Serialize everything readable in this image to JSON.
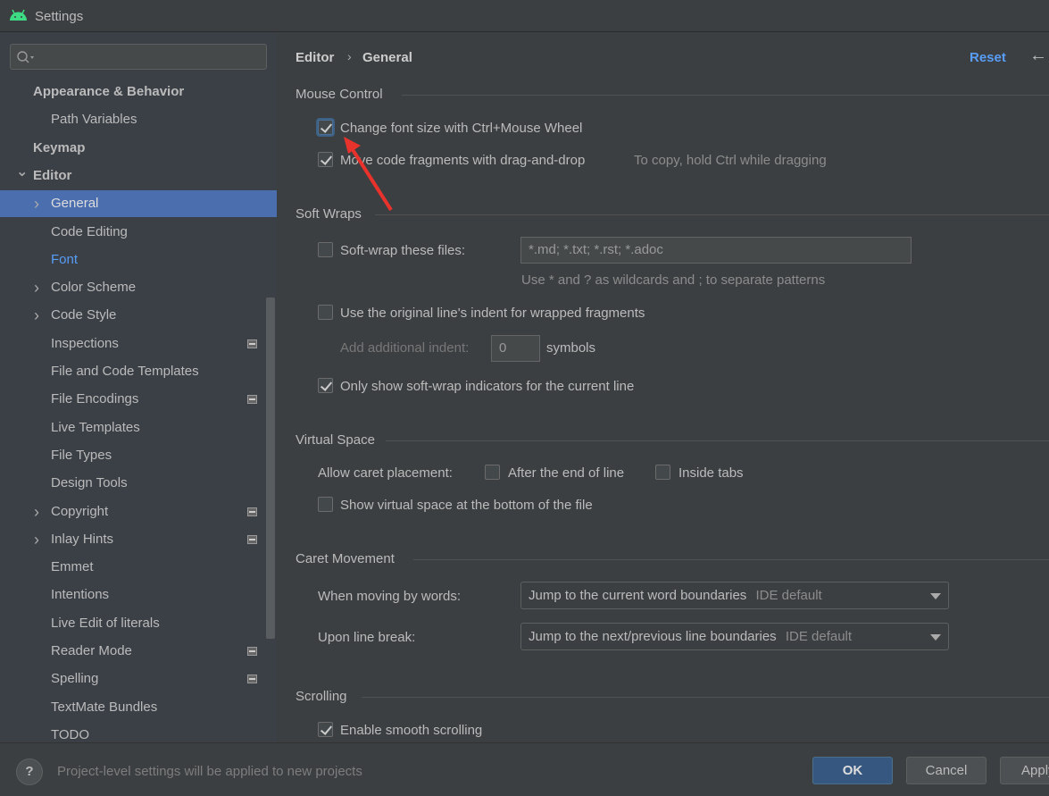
{
  "window": {
    "title": "Settings",
    "icon": "android-icon"
  },
  "search": {
    "placeholder": "",
    "icon": "search-icon"
  },
  "sidebar": {
    "items": [
      {
        "label": "Appearance & Behavior",
        "level": 0,
        "bold": true
      },
      {
        "label": "Path Variables",
        "level": 1
      },
      {
        "label": "Keymap",
        "level": 0,
        "bold": true
      },
      {
        "label": "Editor",
        "level": 0,
        "bold": true,
        "chevron": "down"
      },
      {
        "label": "General",
        "level": 1,
        "chevron": "right",
        "selected": true
      },
      {
        "label": "Code Editing",
        "level": 1
      },
      {
        "label": "Font",
        "level": 1,
        "color": "#589df6"
      },
      {
        "label": "Color Scheme",
        "level": 1,
        "chevron": "right"
      },
      {
        "label": "Code Style",
        "level": 1,
        "chevron": "right"
      },
      {
        "label": "Inspections",
        "level": 1,
        "project_icon": true
      },
      {
        "label": "File and Code Templates",
        "level": 1
      },
      {
        "label": "File Encodings",
        "level": 1,
        "project_icon": true
      },
      {
        "label": "Live Templates",
        "level": 1
      },
      {
        "label": "File Types",
        "level": 1
      },
      {
        "label": "Design Tools",
        "level": 1
      },
      {
        "label": "Copyright",
        "level": 1,
        "chevron": "right",
        "project_icon": true
      },
      {
        "label": "Inlay Hints",
        "level": 1,
        "chevron": "right",
        "project_icon": true
      },
      {
        "label": "Emmet",
        "level": 1
      },
      {
        "label": "Intentions",
        "level": 1
      },
      {
        "label": "Live Edit of literals",
        "level": 1
      },
      {
        "label": "Reader Mode",
        "level": 1,
        "project_icon": true
      },
      {
        "label": "Spelling",
        "level": 1,
        "project_icon": true
      },
      {
        "label": "TextMate Bundles",
        "level": 1
      },
      {
        "label": "TODO",
        "level": 1
      }
    ]
  },
  "header": {
    "breadcrumb": [
      "Editor",
      "General"
    ],
    "separator": "›",
    "reset": "Reset",
    "back_icon": "arrow-left-icon"
  },
  "mouse_control": {
    "title": "Mouse Control",
    "change_font": {
      "label": "Change font size with Ctrl+Mouse Wheel",
      "checked": true
    },
    "drag_drop": {
      "label": "Move code fragments with drag-and-drop",
      "checked": true,
      "hint": "To copy, hold Ctrl while dragging"
    }
  },
  "soft_wraps": {
    "title": "Soft Wraps",
    "soft_wrap_files": {
      "label": "Soft-wrap these files:",
      "checked": false,
      "value": "*.md; *.txt; *.rst; *.adoc",
      "hint": "Use * and ? as wildcards and ; to separate patterns"
    },
    "original_indent": {
      "label": "Use the original line's indent for wrapped fragments",
      "checked": false
    },
    "additional_indent": {
      "label": "Add additional indent:",
      "value": "0",
      "unit": "symbols"
    },
    "only_current": {
      "label": "Only show soft-wrap indicators for the current line",
      "checked": true
    }
  },
  "virtual_space": {
    "title": "Virtual Space",
    "caret_label": "Allow caret placement:",
    "after_end": {
      "label": "After the end of line",
      "checked": false
    },
    "inside_tabs": {
      "label": "Inside tabs",
      "checked": false
    },
    "show_bottom": {
      "label": "Show virtual space at the bottom of the file",
      "checked": false
    }
  },
  "caret_movement": {
    "title": "Caret Movement",
    "words": {
      "label": "When moving by words:",
      "value": "Jump to the current word boundaries",
      "hint": "IDE default"
    },
    "line_break": {
      "label": "Upon line break:",
      "value": "Jump to the next/previous line boundaries",
      "hint": "IDE default"
    }
  },
  "scrolling": {
    "title": "Scrolling",
    "smooth": {
      "label": "Enable smooth scrolling",
      "checked": true
    }
  },
  "footer": {
    "help": "?",
    "message": "Project-level settings will be applied to new projects",
    "ok": "OK",
    "cancel": "Cancel",
    "apply": "Apply"
  },
  "annotation": {
    "type": "red-arrow",
    "color": "#e8322c"
  }
}
